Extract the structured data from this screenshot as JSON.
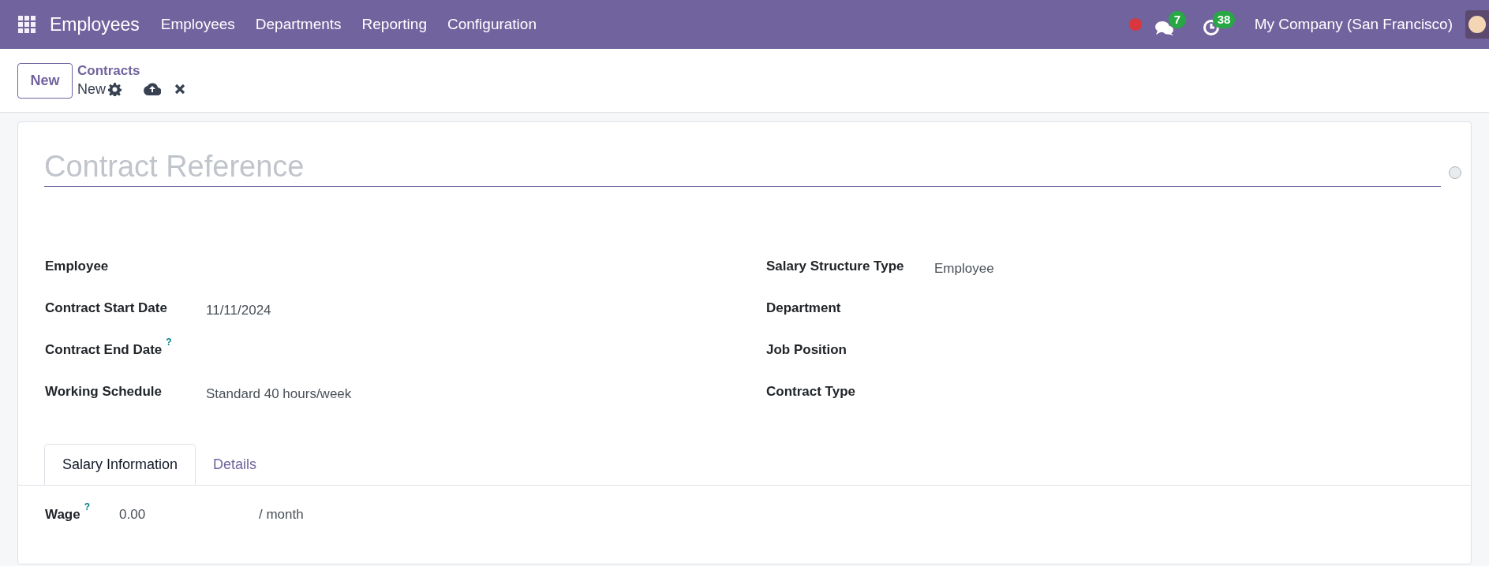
{
  "navbar": {
    "app_name": "Employees",
    "menu": [
      "Employees",
      "Departments",
      "Reporting",
      "Configuration"
    ],
    "chat_count": "7",
    "activity_count": "38",
    "company": "My Company (San Francisco)"
  },
  "control_panel": {
    "new_button": "New",
    "breadcrumb": "Contracts",
    "record_name": "New"
  },
  "form": {
    "title_placeholder": "Contract Reference",
    "left_fields": [
      {
        "label": "Employee"
      },
      {
        "label": "Contract Start Date",
        "value": "11/11/2024"
      },
      {
        "label": "Contract End Date",
        "help_mark": "?"
      },
      {
        "label": "Working Schedule",
        "value": "Standard 40 hours/week"
      }
    ],
    "right_fields": [
      {
        "label": "Salary Structure Type",
        "value": "Employee"
      },
      {
        "label": "Department"
      },
      {
        "label": "Job Position"
      },
      {
        "label": "Contract Type"
      }
    ],
    "tabs": [
      {
        "label": "Salary Information",
        "selected": true
      },
      {
        "label": "Details",
        "selected": false
      }
    ],
    "wage": {
      "label": "Wage",
      "help_mark": "?",
      "value": "0.00",
      "unit": "/ month"
    }
  }
}
